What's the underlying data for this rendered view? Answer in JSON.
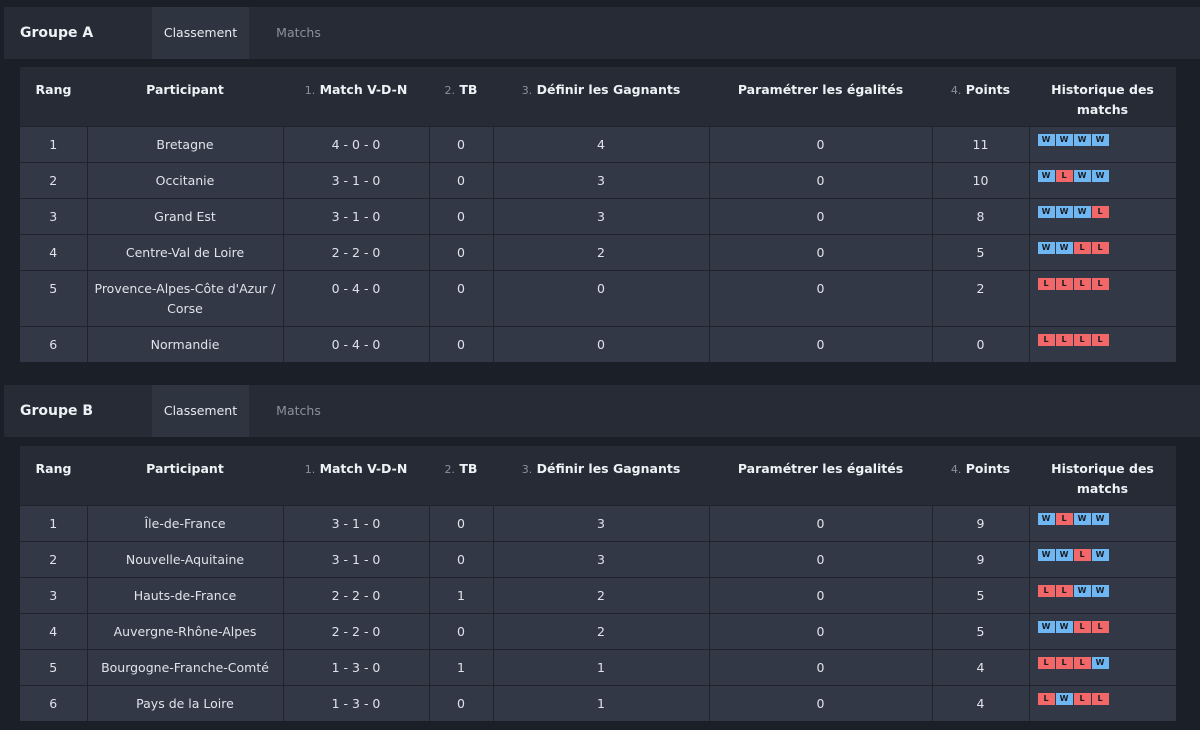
{
  "colors": {
    "win": "#6fb7f2",
    "loss": "#f26767",
    "background": "#1b1f27",
    "cell": "#323845",
    "header": "#262b35"
  },
  "tabs": {
    "standings": "Classement",
    "matches": "Matchs"
  },
  "columns": {
    "rank": "Rang",
    "participant": "Participant",
    "match_num": "1.",
    "match": "Match V-D-N",
    "tb_num": "2.",
    "tb": "TB",
    "winners_num": "3.",
    "winners": "Définir les Gagnants",
    "ties": "Paramétrer les égalités",
    "points_num": "4.",
    "points": "Points",
    "history": "Historique des matchs"
  },
  "groups": [
    {
      "name": "Groupe A",
      "rows": [
        {
          "rank": "1",
          "participant": "Bretagne",
          "record": "4 - 0 - 0",
          "tb": "0",
          "winners": "4",
          "ties": "0",
          "points": "11",
          "history": [
            "W",
            "W",
            "W",
            "W"
          ]
        },
        {
          "rank": "2",
          "participant": "Occitanie",
          "record": "3 - 1 - 0",
          "tb": "0",
          "winners": "3",
          "ties": "0",
          "points": "10",
          "history": [
            "W",
            "L",
            "W",
            "W"
          ]
        },
        {
          "rank": "3",
          "participant": "Grand Est",
          "record": "3 - 1 - 0",
          "tb": "0",
          "winners": "3",
          "ties": "0",
          "points": "8",
          "history": [
            "W",
            "W",
            "W",
            "L"
          ]
        },
        {
          "rank": "4",
          "participant": "Centre-Val de Loire",
          "record": "2 - 2 - 0",
          "tb": "0",
          "winners": "2",
          "ties": "0",
          "points": "5",
          "history": [
            "W",
            "W",
            "L",
            "L"
          ]
        },
        {
          "rank": "5",
          "participant": "Provence-Alpes-Côte d'Azur / Corse",
          "record": "0 - 4 - 0",
          "tb": "0",
          "winners": "0",
          "ties": "0",
          "points": "2",
          "history": [
            "L",
            "L",
            "L",
            "L"
          ]
        },
        {
          "rank": "6",
          "participant": "Normandie",
          "record": "0 - 4 - 0",
          "tb": "0",
          "winners": "0",
          "ties": "0",
          "points": "0",
          "history": [
            "L",
            "L",
            "L",
            "L"
          ]
        }
      ]
    },
    {
      "name": "Groupe B",
      "rows": [
        {
          "rank": "1",
          "participant": "Île-de-France",
          "record": "3 - 1 - 0",
          "tb": "0",
          "winners": "3",
          "ties": "0",
          "points": "9",
          "history": [
            "W",
            "L",
            "W",
            "W"
          ]
        },
        {
          "rank": "2",
          "participant": "Nouvelle-Aquitaine",
          "record": "3 - 1 - 0",
          "tb": "0",
          "winners": "3",
          "ties": "0",
          "points": "9",
          "history": [
            "W",
            "W",
            "L",
            "W"
          ]
        },
        {
          "rank": "3",
          "participant": "Hauts-de-France",
          "record": "2 - 2 - 0",
          "tb": "1",
          "winners": "2",
          "ties": "0",
          "points": "5",
          "history": [
            "L",
            "L",
            "W",
            "W"
          ]
        },
        {
          "rank": "4",
          "participant": "Auvergne-Rhône-Alpes",
          "record": "2 - 2 - 0",
          "tb": "0",
          "winners": "2",
          "ties": "0",
          "points": "5",
          "history": [
            "W",
            "W",
            "L",
            "L"
          ]
        },
        {
          "rank": "5",
          "participant": "Bourgogne-Franche-Comté",
          "record": "1 - 3 - 0",
          "tb": "1",
          "winners": "1",
          "ties": "0",
          "points": "4",
          "history": [
            "L",
            "L",
            "L",
            "W"
          ]
        },
        {
          "rank": "6",
          "participant": "Pays de la Loire",
          "record": "1 - 3 - 0",
          "tb": "0",
          "winners": "1",
          "ties": "0",
          "points": "4",
          "history": [
            "L",
            "W",
            "L",
            "L"
          ]
        }
      ]
    }
  ]
}
